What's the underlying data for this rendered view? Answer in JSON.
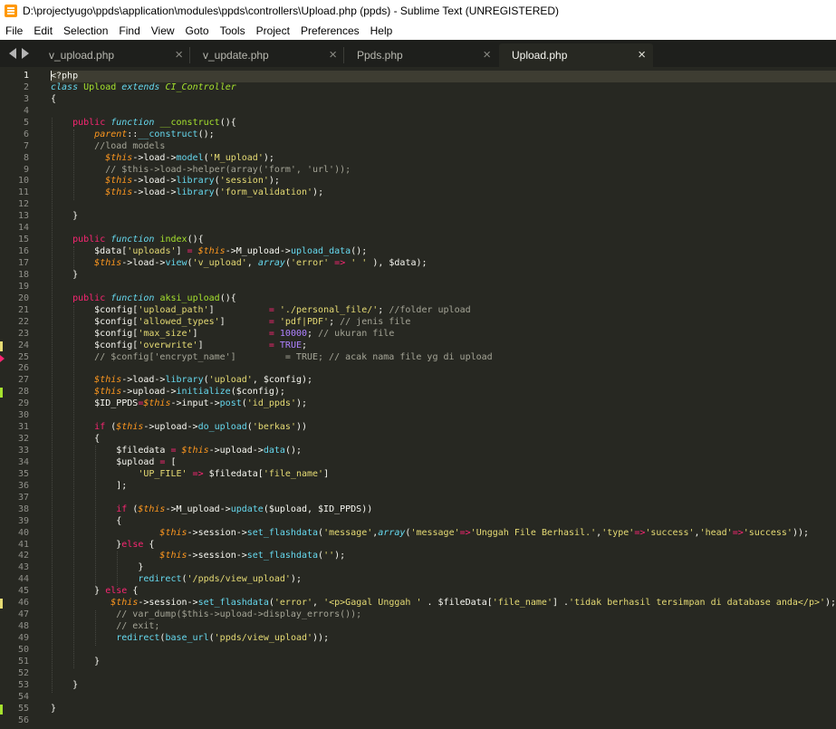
{
  "window": {
    "title": "D:\\projectyugo\\ppds\\application\\modules\\ppds\\controllers\\Upload.php (ppds) - Sublime Text (UNREGISTERED)"
  },
  "menu": [
    "File",
    "Edit",
    "Selection",
    "Find",
    "View",
    "Goto",
    "Tools",
    "Project",
    "Preferences",
    "Help"
  ],
  "tabs": [
    {
      "label": "v_upload.php",
      "active": false
    },
    {
      "label": "v_update.php",
      "active": false
    },
    {
      "label": "Ppds.php",
      "active": false
    },
    {
      "label": "Upload.php",
      "active": true
    }
  ],
  "tab_close_glyph": "×",
  "icons": {
    "app": "sublime-text-icon",
    "nav_left": "chevron-left-icon",
    "nav_right": "chevron-right-icon",
    "close": "close-icon"
  },
  "colors": {
    "editor_bg": "#272822",
    "keyword": "#f92672",
    "function": "#a6e22e",
    "string": "#e6db74",
    "storage": "#66d9ef",
    "this": "#fd971f",
    "number": "#ae81ff",
    "comment": "#a5a597"
  },
  "editor": {
    "current_line": 1,
    "line_marks": {
      "24": "mod",
      "25": "del",
      "28": "add",
      "46": "mod",
      "55": "add"
    },
    "lines": [
      [
        [
          "<?php",
          ""
        ]
      ],
      [
        [
          "class",
          "t-storage"
        ],
        [
          " ",
          ""
        ],
        [
          "Upload",
          "t-class"
        ],
        [
          " ",
          ""
        ],
        [
          "extends",
          "t-storage"
        ],
        [
          " ",
          ""
        ],
        [
          "CI_Controller",
          "t-inherit"
        ]
      ],
      [
        [
          "{",
          ""
        ]
      ],
      [
        [
          "",
          ""
        ]
      ],
      [
        [
          "    ",
          ""
        ],
        [
          "public",
          "t-kw"
        ],
        [
          " ",
          ""
        ],
        [
          "function",
          "t-storage"
        ],
        [
          " ",
          ""
        ],
        [
          "__construct",
          "t-fn"
        ],
        [
          "(){",
          ""
        ]
      ],
      [
        [
          "        ",
          ""
        ],
        [
          "parent",
          "t-parent"
        ],
        [
          "::",
          ""
        ],
        [
          "__construct",
          "t-call"
        ],
        [
          "();",
          ""
        ]
      ],
      [
        [
          "        ",
          ""
        ],
        [
          "//load models",
          "t-comment"
        ]
      ],
      [
        [
          "          ",
          ""
        ],
        [
          "$this",
          "t-this"
        ],
        [
          "->load->",
          ""
        ],
        [
          "model",
          "t-call"
        ],
        [
          "(",
          ""
        ],
        [
          "'M_upload'",
          "t-str"
        ],
        [
          ");",
          ""
        ]
      ],
      [
        [
          "          ",
          ""
        ],
        [
          "// $this->load->helper(array('form', 'url'));",
          "t-comment"
        ]
      ],
      [
        [
          "          ",
          ""
        ],
        [
          "$this",
          "t-this"
        ],
        [
          "->load->",
          ""
        ],
        [
          "library",
          "t-call"
        ],
        [
          "(",
          ""
        ],
        [
          "'session'",
          "t-str"
        ],
        [
          ");",
          ""
        ]
      ],
      [
        [
          "          ",
          ""
        ],
        [
          "$this",
          "t-this"
        ],
        [
          "->load->",
          ""
        ],
        [
          "library",
          "t-call"
        ],
        [
          "(",
          ""
        ],
        [
          "'form_validation'",
          "t-str"
        ],
        [
          ");",
          ""
        ]
      ],
      [
        [
          "",
          ""
        ]
      ],
      [
        [
          "    }",
          ""
        ]
      ],
      [
        [
          "",
          ""
        ]
      ],
      [
        [
          "    ",
          ""
        ],
        [
          "public",
          "t-kw"
        ],
        [
          " ",
          ""
        ],
        [
          "function",
          "t-storage"
        ],
        [
          " ",
          ""
        ],
        [
          "index",
          "t-fn"
        ],
        [
          "(){",
          ""
        ]
      ],
      [
        [
          "        $data[",
          ""
        ],
        [
          "'uploads'",
          "t-str"
        ],
        [
          "] ",
          ""
        ],
        [
          "=",
          "t-op"
        ],
        [
          " ",
          ""
        ],
        [
          "$this",
          "t-this"
        ],
        [
          "->M_upload->",
          ""
        ],
        [
          "upload_data",
          "t-call"
        ],
        [
          "();",
          ""
        ]
      ],
      [
        [
          "        ",
          ""
        ],
        [
          "$this",
          "t-this"
        ],
        [
          "->load->",
          ""
        ],
        [
          "view",
          "t-call"
        ],
        [
          "(",
          ""
        ],
        [
          "'v_upload'",
          "t-str"
        ],
        [
          ", ",
          ""
        ],
        [
          "array",
          "t-storage"
        ],
        [
          "(",
          ""
        ],
        [
          "'error'",
          "t-str"
        ],
        [
          " ",
          ""
        ],
        [
          "=>",
          "t-op"
        ],
        [
          " ",
          ""
        ],
        [
          "' '",
          "t-str"
        ],
        [
          " ), $data);",
          ""
        ]
      ],
      [
        [
          "    }",
          ""
        ]
      ],
      [
        [
          "",
          ""
        ]
      ],
      [
        [
          "    ",
          ""
        ],
        [
          "public",
          "t-kw"
        ],
        [
          " ",
          ""
        ],
        [
          "function",
          "t-storage"
        ],
        [
          " ",
          ""
        ],
        [
          "aksi_upload",
          "t-fn"
        ],
        [
          "(){",
          ""
        ]
      ],
      [
        [
          "        $config[",
          ""
        ],
        [
          "'upload_path'",
          "t-str"
        ],
        [
          "]          ",
          ""
        ],
        [
          "=",
          "t-op"
        ],
        [
          " ",
          ""
        ],
        [
          "'./personal_file/'",
          "t-str"
        ],
        [
          "; ",
          ""
        ],
        [
          "//folder upload",
          "t-comment"
        ]
      ],
      [
        [
          "        $config[",
          ""
        ],
        [
          "'allowed_types'",
          "t-str"
        ],
        [
          "]        ",
          ""
        ],
        [
          "=",
          "t-op"
        ],
        [
          " ",
          ""
        ],
        [
          "'pdf|PDF'",
          "t-str"
        ],
        [
          "; ",
          ""
        ],
        [
          "// jenis file",
          "t-comment"
        ]
      ],
      [
        [
          "        $config[",
          ""
        ],
        [
          "'max_size'",
          "t-str"
        ],
        [
          "]             ",
          ""
        ],
        [
          "=",
          "t-op"
        ],
        [
          " ",
          ""
        ],
        [
          "10000",
          "t-num"
        ],
        [
          "; ",
          ""
        ],
        [
          "// ukuran file",
          "t-comment"
        ]
      ],
      [
        [
          "        $config[",
          ""
        ],
        [
          "'overwrite'",
          "t-str"
        ],
        [
          "]            ",
          ""
        ],
        [
          "=",
          "t-op"
        ],
        [
          " ",
          ""
        ],
        [
          "TRUE",
          "t-const"
        ],
        [
          ";",
          ""
        ]
      ],
      [
        [
          "        ",
          ""
        ],
        [
          "// $config['encrypt_name']         = TRUE; // acak nama file yg di upload",
          "t-comment"
        ]
      ],
      [
        [
          "",
          ""
        ]
      ],
      [
        [
          "        ",
          ""
        ],
        [
          "$this",
          "t-this"
        ],
        [
          "->load->",
          ""
        ],
        [
          "library",
          "t-call"
        ],
        [
          "(",
          ""
        ],
        [
          "'upload'",
          "t-str"
        ],
        [
          ", $config);",
          ""
        ]
      ],
      [
        [
          "        ",
          ""
        ],
        [
          "$this",
          "t-this"
        ],
        [
          "->upload->",
          ""
        ],
        [
          "initialize",
          "t-call"
        ],
        [
          "($config);",
          ""
        ]
      ],
      [
        [
          "        $ID_PPDS",
          ""
        ],
        [
          "=",
          "t-op"
        ],
        [
          "$this",
          "t-this"
        ],
        [
          "->input->",
          ""
        ],
        [
          "post",
          "t-call"
        ],
        [
          "(",
          ""
        ],
        [
          "'id_ppds'",
          "t-str"
        ],
        [
          ");",
          ""
        ]
      ],
      [
        [
          "",
          ""
        ]
      ],
      [
        [
          "        ",
          ""
        ],
        [
          "if",
          "t-kw"
        ],
        [
          " (",
          ""
        ],
        [
          "$this",
          "t-this"
        ],
        [
          "->upload->",
          ""
        ],
        [
          "do_upload",
          "t-call"
        ],
        [
          "(",
          ""
        ],
        [
          "'berkas'",
          "t-str"
        ],
        [
          "))",
          ""
        ]
      ],
      [
        [
          "        {",
          ""
        ]
      ],
      [
        [
          "            $filedata ",
          ""
        ],
        [
          "=",
          "t-op"
        ],
        [
          " ",
          ""
        ],
        [
          "$this",
          "t-this"
        ],
        [
          "->upload->",
          ""
        ],
        [
          "data",
          "t-call"
        ],
        [
          "();",
          ""
        ]
      ],
      [
        [
          "            $upload ",
          ""
        ],
        [
          "=",
          "t-op"
        ],
        [
          " [",
          ""
        ]
      ],
      [
        [
          "                ",
          ""
        ],
        [
          "'UP_FILE'",
          "t-str"
        ],
        [
          " ",
          ""
        ],
        [
          "=>",
          "t-op"
        ],
        [
          " $filedata[",
          ""
        ],
        [
          "'file_name'",
          "t-str"
        ],
        [
          "]",
          ""
        ]
      ],
      [
        [
          "            ];",
          ""
        ]
      ],
      [
        [
          "",
          ""
        ]
      ],
      [
        [
          "            ",
          ""
        ],
        [
          "if",
          "t-kw"
        ],
        [
          " (",
          ""
        ],
        [
          "$this",
          "t-this"
        ],
        [
          "->M_upload->",
          ""
        ],
        [
          "update",
          "t-call"
        ],
        [
          "($upload, $ID_PPDS))",
          ""
        ]
      ],
      [
        [
          "            {",
          ""
        ]
      ],
      [
        [
          "                    ",
          ""
        ],
        [
          "$this",
          "t-this"
        ],
        [
          "->session->",
          ""
        ],
        [
          "set_flashdata",
          "t-call"
        ],
        [
          "(",
          ""
        ],
        [
          "'message'",
          "t-str"
        ],
        [
          ",",
          ""
        ],
        [
          "array",
          "t-storage"
        ],
        [
          "(",
          ""
        ],
        [
          "'message'",
          "t-str"
        ],
        [
          "=>",
          "t-op"
        ],
        [
          "'Unggah File Berhasil.'",
          "t-str"
        ],
        [
          ",",
          ""
        ],
        [
          "'type'",
          "t-str"
        ],
        [
          "=>",
          "t-op"
        ],
        [
          "'success'",
          "t-str"
        ],
        [
          ",",
          ""
        ],
        [
          "'head'",
          "t-str"
        ],
        [
          "=>",
          "t-op"
        ],
        [
          "'success'",
          "t-str"
        ],
        [
          "));",
          ""
        ]
      ],
      [
        [
          "            }",
          ""
        ],
        [
          "else",
          "t-kw"
        ],
        [
          " {",
          ""
        ]
      ],
      [
        [
          "                    ",
          ""
        ],
        [
          "$this",
          "t-this"
        ],
        [
          "->session->",
          ""
        ],
        [
          "set_flashdata",
          "t-call"
        ],
        [
          "(",
          ""
        ],
        [
          "''",
          "t-str"
        ],
        [
          ");",
          ""
        ]
      ],
      [
        [
          "                }",
          ""
        ]
      ],
      [
        [
          "                ",
          ""
        ],
        [
          "redirect",
          "t-call"
        ],
        [
          "(",
          ""
        ],
        [
          "'/ppds/view_upload'",
          "t-str"
        ],
        [
          ");",
          ""
        ]
      ],
      [
        [
          "        } ",
          ""
        ],
        [
          "else",
          "t-kw"
        ],
        [
          " {",
          ""
        ]
      ],
      [
        [
          "           ",
          ""
        ],
        [
          "$this",
          "t-this"
        ],
        [
          "->session->",
          ""
        ],
        [
          "set_flashdata",
          "t-call"
        ],
        [
          "(",
          ""
        ],
        [
          "'error'",
          "t-str"
        ],
        [
          ", ",
          ""
        ],
        [
          "'<p>Gagal Unggah '",
          "t-str"
        ],
        [
          " . $fileData[",
          ""
        ],
        [
          "'file_name'",
          "t-str"
        ],
        [
          "] .",
          ""
        ],
        [
          "'tidak berhasil tersimpan di database anda</p>'",
          "t-str"
        ],
        [
          ");",
          ""
        ]
      ],
      [
        [
          "            ",
          ""
        ],
        [
          "// var_dump($this->upload->display_errors());",
          "t-comment"
        ]
      ],
      [
        [
          "            ",
          ""
        ],
        [
          "// exit;",
          "t-comment"
        ]
      ],
      [
        [
          "            ",
          ""
        ],
        [
          "redirect",
          "t-call"
        ],
        [
          "(",
          ""
        ],
        [
          "base_url",
          "t-call"
        ],
        [
          "(",
          ""
        ],
        [
          "'ppds/view_upload'",
          "t-str"
        ],
        [
          "));",
          ""
        ]
      ],
      [
        [
          "",
          ""
        ]
      ],
      [
        [
          "        }",
          ""
        ]
      ],
      [
        [
          "",
          ""
        ]
      ],
      [
        [
          "    }",
          ""
        ]
      ],
      [
        [
          "",
          ""
        ]
      ],
      [
        [
          "}",
          ""
        ]
      ],
      [
        [
          "",
          ""
        ]
      ]
    ]
  }
}
